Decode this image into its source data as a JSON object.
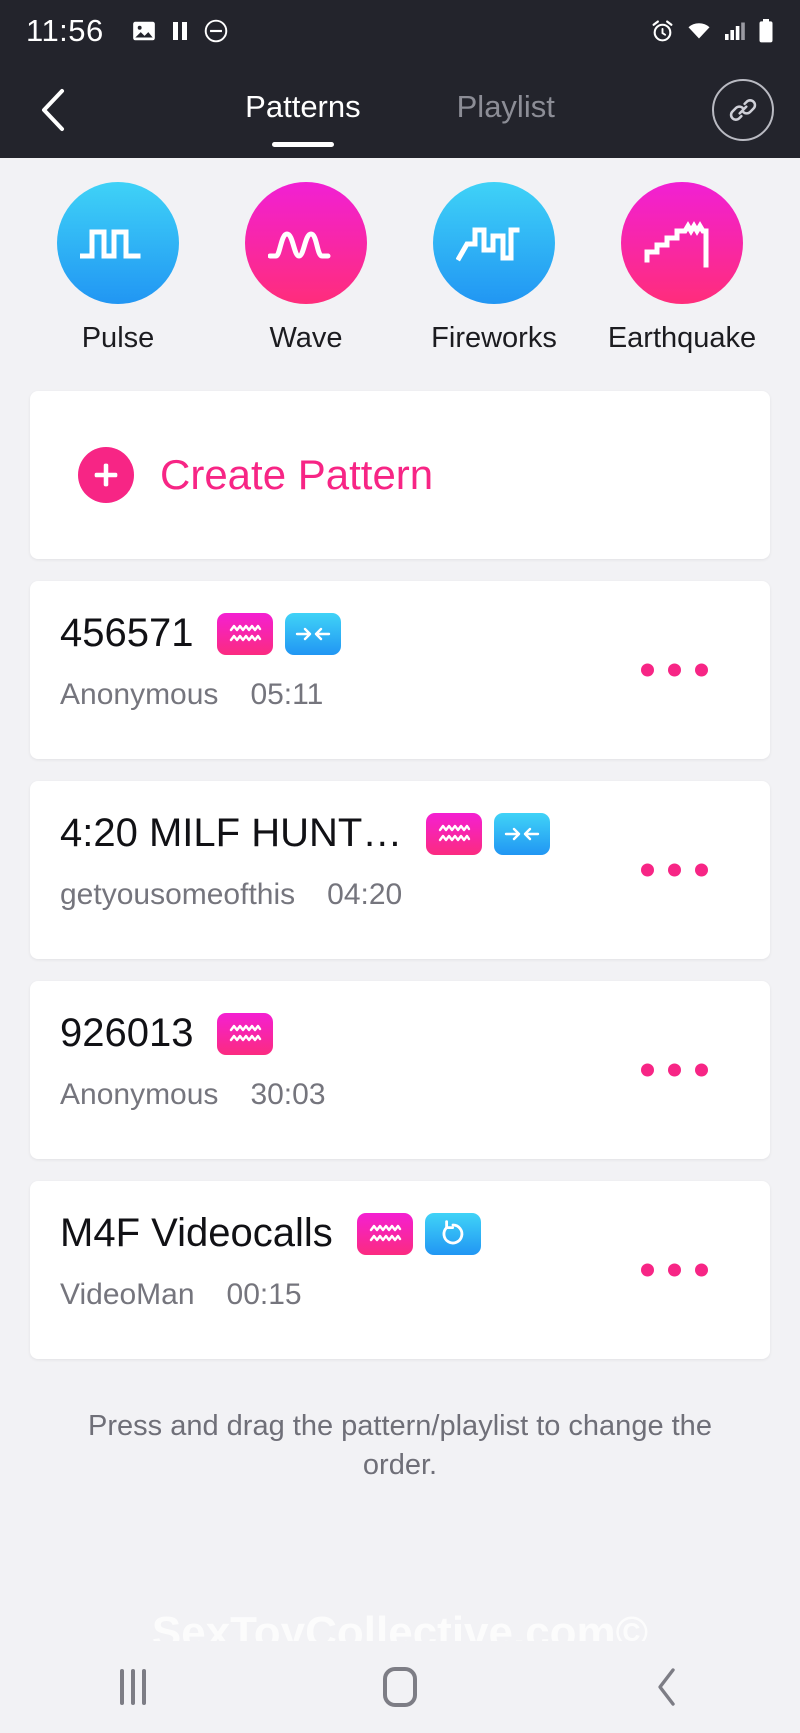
{
  "status_bar": {
    "time": "11:56",
    "left_icons": [
      "image-icon",
      "pause-icon",
      "do-not-disturb-icon"
    ],
    "right_icons": [
      "alarm-icon",
      "wifi-icon",
      "cellular-signal-icon",
      "battery-icon"
    ],
    "background": "#23242c"
  },
  "header": {
    "back_label": "back-chevron",
    "tabs": [
      {
        "label": "Patterns",
        "active": true
      },
      {
        "label": "Playlist",
        "active": false
      }
    ],
    "link_button": "link-icon"
  },
  "patterns": [
    {
      "name": "Pulse",
      "color": "blue",
      "icon": "square-wave-icon"
    },
    {
      "name": "Wave",
      "color": "pink",
      "icon": "sine-wave-icon"
    },
    {
      "name": "Fireworks",
      "color": "blue",
      "icon": "step-wave-icon"
    },
    {
      "name": "Earthquake",
      "color": "pink",
      "icon": "staircase-wave-icon"
    }
  ],
  "create": {
    "label": "Create Pattern",
    "icon": "plus-icon",
    "color": "#f72585"
  },
  "list": [
    {
      "title": "456571",
      "author": "Anonymous",
      "duration": "05:11",
      "badges": [
        "vibration-badge",
        "contract-arrows-badge"
      ]
    },
    {
      "title": "4:20 MILF HUNT…",
      "author": "getyousomeofthis",
      "duration": "04:20",
      "badges": [
        "vibration-badge",
        "contract-arrows-badge"
      ]
    },
    {
      "title": "926013",
      "author": "Anonymous",
      "duration": "30:03",
      "badges": [
        "vibration-badge"
      ]
    },
    {
      "title": "M4F Videocalls",
      "author": "VideoMan",
      "duration": "00:15",
      "badges": [
        "vibration-badge",
        "rotation-badge"
      ]
    }
  ],
  "footer": {
    "hint": "Press and drag the pattern/playlist to change the order.",
    "watermark": "SexToyCollective.com©"
  },
  "navbar": {
    "recents": "recents-icon",
    "home": "home-icon",
    "back": "back-icon"
  },
  "colors": {
    "accent_pink": "#f72585",
    "accent_blue": "#2196f3",
    "page_bg": "#f2f2f5",
    "bar_bg": "#23242c"
  }
}
